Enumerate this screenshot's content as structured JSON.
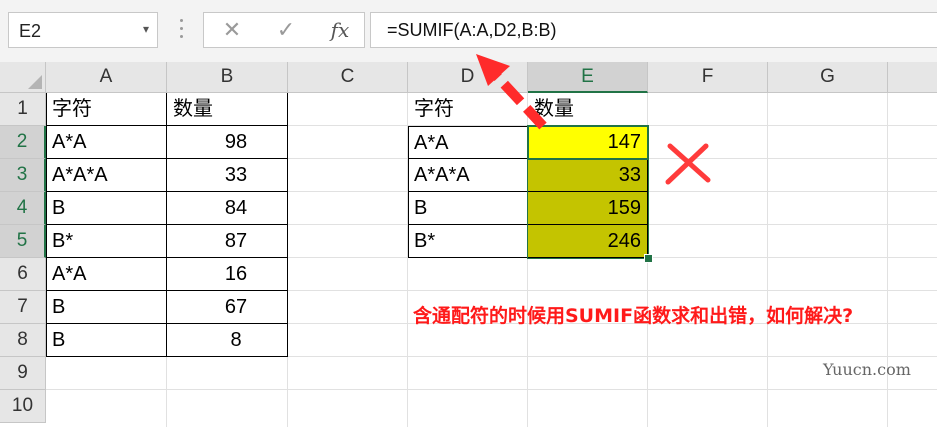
{
  "formula_bar": {
    "name_box": "E2",
    "name_box_dropdown": "▾",
    "cancel_glyph": "✕",
    "enter_glyph": "✓",
    "fx_label": "fx",
    "formula": "=SUMIF(A:A,D2,B:B)"
  },
  "columns": [
    "A",
    "B",
    "C",
    "D",
    "E",
    "F",
    "G"
  ],
  "rows": [
    "1",
    "2",
    "3",
    "4",
    "5",
    "6",
    "7",
    "8",
    "9",
    "10"
  ],
  "cells": {
    "A1": "字符",
    "B1": "数量",
    "A2": "A*A",
    "B2": "98",
    "A3": "A*A*A",
    "B3": "33",
    "A4": "B",
    "B4": "84",
    "A5": "B*",
    "B5": "87",
    "A6": "A*A",
    "B6": "16",
    "A7": "B",
    "B7": "67",
    "A8": "B",
    "B8": "8",
    "D1": "字符",
    "E1": "数量",
    "D2": "A*A",
    "E2": "147",
    "D3": "A*A*A",
    "E3": "33",
    "D4": "B",
    "E4": "159",
    "D5": "B*",
    "E5": "246"
  },
  "fill_colors": {
    "E2": "#ffff00",
    "E3_E5": "#c4c400"
  },
  "annotation": "含通配符的时候用SUMIF函数求和出错，如何解决?",
  "annotation_color": "#ff1a1a",
  "arrow_icon": "red-dashed-arrow-icon",
  "cross_icon": "red-cross-icon",
  "watermark": "Yuucn.com",
  "accent_color": "#217346"
}
